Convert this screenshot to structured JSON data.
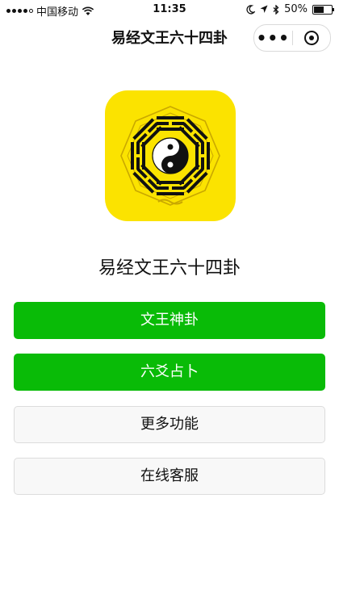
{
  "status_bar": {
    "carrier": "中国移动",
    "time": "11:35",
    "battery": "50%",
    "signal_bars_filled": 4,
    "battery_level": 0.5
  },
  "nav": {
    "title": "易经文王六十四卦",
    "more_label": "•••"
  },
  "app": {
    "name": "易经文王六十四卦"
  },
  "buttons": {
    "wenwang": "文王神卦",
    "liuyao": "六爻占卜",
    "more": "更多功能",
    "service": "在线客服"
  },
  "colors": {
    "primary_green": "#09bb07",
    "logo_yellow": "#fbe300"
  },
  "icons": [
    "wifi-icon",
    "moon-icon",
    "location-icon",
    "bluetooth-icon",
    "battery-icon",
    "more-dots-icon",
    "close-circle-icon",
    "bagua-logo-icon"
  ]
}
